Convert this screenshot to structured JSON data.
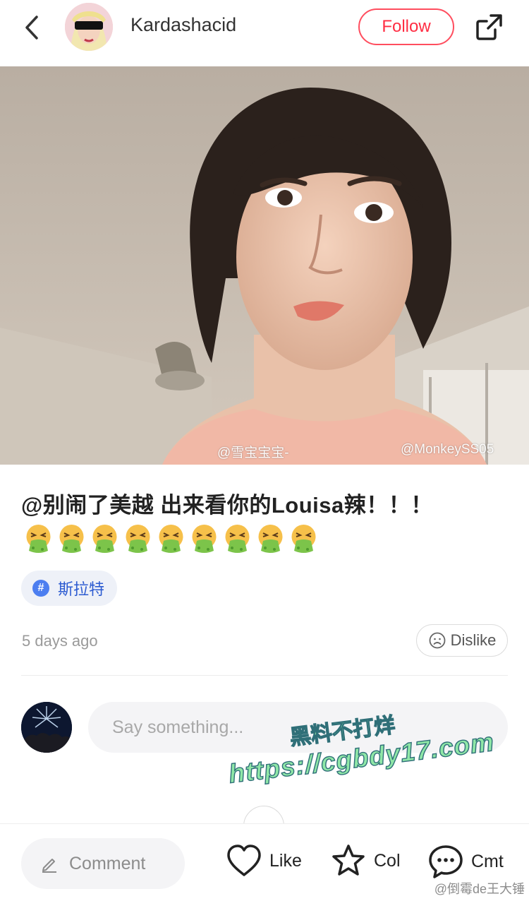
{
  "header": {
    "username": "Kardashacid",
    "follow_label": "Follow"
  },
  "photo": {
    "watermark_left": "@雪宝宝宝-",
    "watermark_right": "@MonkeySS05"
  },
  "post": {
    "text": "@别闹了美越 出来看你的Louisa辣！！！",
    "emoji_count": 9,
    "tag": "斯拉特",
    "tag_icon": "#",
    "time": "5 days ago",
    "dislike_label": "Dislike"
  },
  "comment_input": {
    "placeholder": "Say something..."
  },
  "overlay": {
    "line1": "黑料不打烊",
    "line2": "https://cgbdy17.com"
  },
  "bottom_bar": {
    "comment_label": "Comment",
    "like_label": "Like",
    "collect_label": "Col",
    "cmt_label": "Cmt",
    "credit": "@倒霉de王大锤"
  },
  "colors": {
    "accent_red": "#ff2d43",
    "tag_blue": "#2c5bd1",
    "emoji_face": "#f6c04a",
    "emoji_vomit": "#7cc44a"
  }
}
